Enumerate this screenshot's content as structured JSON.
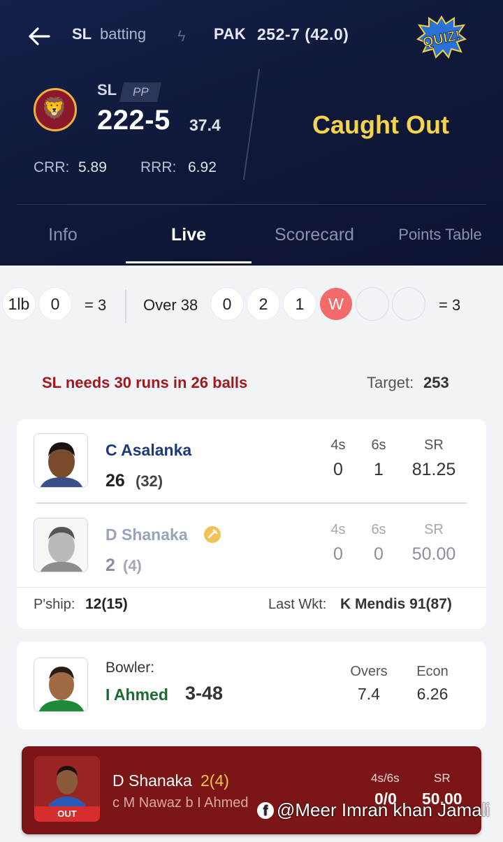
{
  "topbar": {
    "batting_team": "SL",
    "batting_status": "batting",
    "opponent": "PAK",
    "opponent_score": "252-7 (42.0)",
    "quiz_label": "QUIZ!"
  },
  "innings": {
    "team": "SL",
    "powerplay": "PP",
    "score": "222-5",
    "overs": "37.4",
    "crr_label": "CRR:",
    "crr": "5.89",
    "rrr_label": "RRR:",
    "rrr": "6.92",
    "event": "Caught Out"
  },
  "tabs": [
    {
      "label": "Info"
    },
    {
      "label": "Live"
    },
    {
      "label": "Scorecard"
    },
    {
      "label": "Points Table"
    }
  ],
  "ball_strip": {
    "prev_balls": [
      "1lb",
      "0"
    ],
    "prev_total": "= 3",
    "over_label": "Over 38",
    "balls": [
      "0",
      "2",
      "1",
      "W",
      "",
      ""
    ],
    "over_total": "= 3"
  },
  "equation": {
    "text": "SL needs 30 runs in 26 balls",
    "target_label": "Target:",
    "target": "253"
  },
  "batters": [
    {
      "name": "C Asalanka",
      "runs": "26",
      "balls": "(32)",
      "fours_label": "4s",
      "sixes_label": "6s",
      "sr_label": "SR",
      "fours": "0",
      "sixes": "1",
      "sr": "81.25"
    },
    {
      "name": "D Shanaka",
      "runs": "2",
      "balls": "(4)",
      "fours_label": "4s",
      "sixes_label": "6s",
      "sr_label": "SR",
      "fours": "0",
      "sixes": "0",
      "sr": "50.00"
    }
  ],
  "partnership": {
    "label": "P'ship:",
    "value": "12(15)",
    "last_wkt_label": "Last Wkt:",
    "last_wkt": "K Mendis 91(87)"
  },
  "bowler": {
    "label": "Bowler:",
    "name": "I Ahmed",
    "figures": "3-48",
    "overs_label": "Overs",
    "overs": "7.4",
    "econ_label": "Econ",
    "econ": "6.26"
  },
  "wicket": {
    "name": "D Shanaka",
    "score": "2(4)",
    "dismissal": "c M Nawaz b I Ahmed",
    "badge": "OUT",
    "boundary_label": "4s/6s",
    "boundary": "0/0",
    "sr_label": "SR",
    "sr": "50.00"
  },
  "watermark": "@Meer Imran khan Jamali",
  "colors": {
    "header_bg": "#10193a",
    "event_yellow": "#f6d44a",
    "wicket_ball": "#f26a6a",
    "needs_red": "#a3181c",
    "bowler_green": "#1a6b31",
    "out_card": "#7c1515"
  }
}
